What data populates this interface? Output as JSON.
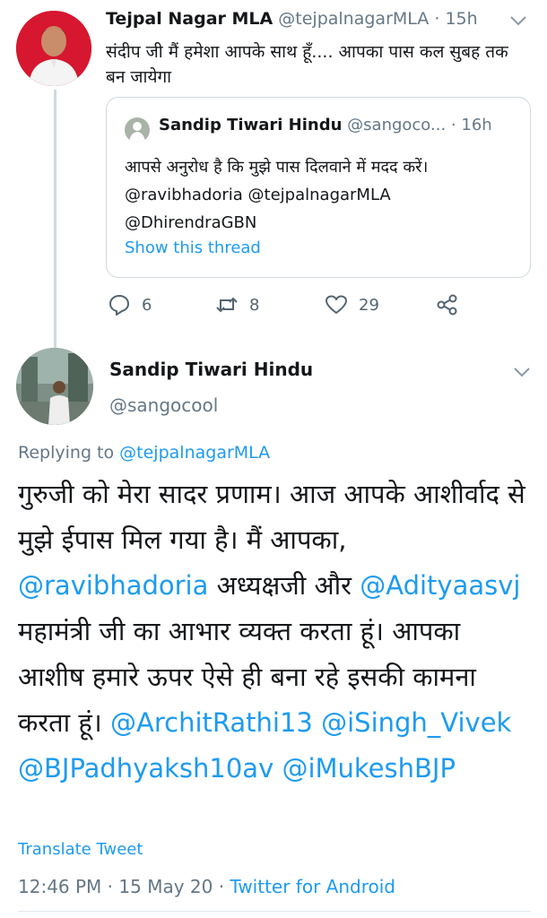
{
  "top_tweet": {
    "author_name": "Tejpal Nagar MLA",
    "author_handle": "@tejpalnagarMLA",
    "separator": "·",
    "time": "15h",
    "text": "संदीप जी मैं हमेशा आपके साथ हूँ.... आपका पास कल सुबह तक बन जायेगा",
    "quoted": {
      "author_name": "Sandip Tiwari Hindu",
      "author_handle": "@sangoco...",
      "separator": "·",
      "time": "16h",
      "text_line1": "आपसे अनुरोध है कि मुझे पास दिलवाने में मदद करें।",
      "text_line2": "@ravibhadoria @tejpalnagarMLA",
      "text_line3": "@DhirendraGBN",
      "show_thread": "Show this thread"
    },
    "actions": {
      "reply_count": "6",
      "retweet_count": "8",
      "like_count": "29"
    }
  },
  "main_tweet": {
    "author_name": "Sandip Tiwari Hindu",
    "author_handle": "@sangocool",
    "replying_prefix": "Replying to",
    "replying_to": "@tejpalnagarMLA",
    "body": {
      "part1": "गुरुजी को मेरा सादर प्रणाम। आज आपके आशीर्वाद से मुझे ईपास मिल गया है। मैं आपका, ",
      "mention1": "@ravibhadoria",
      "part2": " अध्यक्षजी और ",
      "mention2": "@Adityaasvj",
      "part3": " महामंत्री जी का आभार व्यक्त करता हूं। आपका आशीष हमारे ऊपर ऐसे ही बना रहे इसकी कामना करता हूं। ",
      "mention3": "@ArchitRathi13",
      "mention4": "@iSingh_Vivek",
      "mention5": "@BJPadhyaksh10av",
      "mention6": "@iMukeshBJP"
    },
    "translate": "Translate Tweet",
    "timestamp": "12:46 PM · 15 May 20 · ",
    "source": "Twitter for Android"
  },
  "colors": {
    "link": "#1d9bf0",
    "secondary_text": "#657786",
    "primary_text": "#14171a",
    "border": "#cfd9de"
  }
}
